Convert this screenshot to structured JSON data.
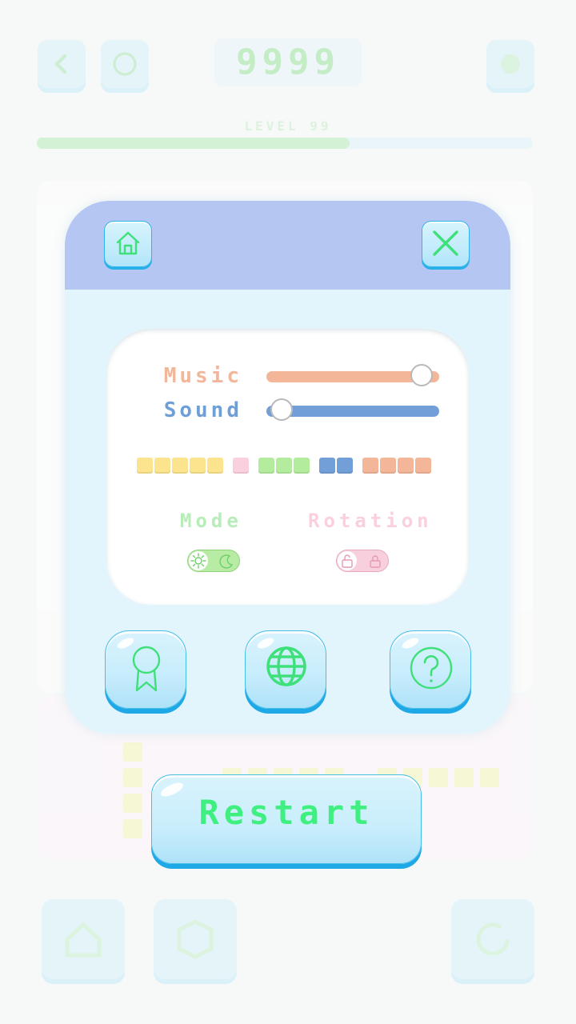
{
  "background": {
    "score": "9999",
    "progress_label": "LEVEL 99",
    "progress_fraction": 0.63
  },
  "settings": {
    "music": {
      "label": "Music",
      "value": 0.9
    },
    "sound": {
      "label": "Sound",
      "value": 0.09
    },
    "palette": [
      "#fbe48d",
      "#fbe48d",
      "#fbe48d",
      "#fbe48d",
      "#fbe48d",
      "#fbd0de",
      "#b4ec9d",
      "#b4ec9d",
      "#b4ec9d",
      "#739fd8",
      "#739fd8",
      "#f4b698",
      "#f4b698",
      "#f4b698",
      "#f4b698"
    ],
    "mode": {
      "label": "Mode",
      "state": "light"
    },
    "rotation": {
      "label": "Rotation",
      "state": "unlocked"
    }
  },
  "actions": {
    "restart_label": "Restart",
    "icons": [
      "home-icon",
      "close-icon",
      "award-icon",
      "globe-icon",
      "help-icon"
    ]
  },
  "colors": {
    "icon_green": "#3fe07a",
    "header": "#b5c6f3",
    "panel": "#e2f5fd"
  }
}
